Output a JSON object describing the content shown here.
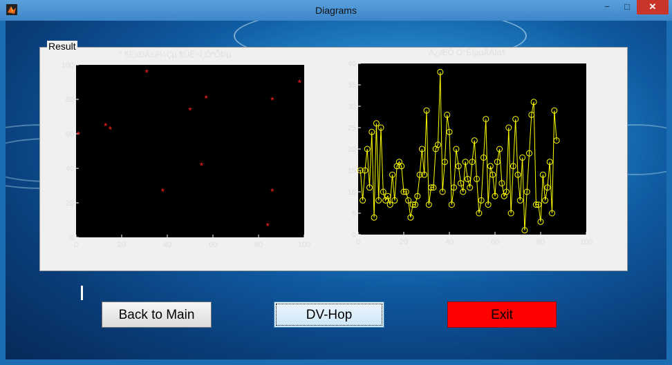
{
  "window": {
    "title": "Diagrams",
    "controls": {
      "minimize": "−",
      "maximize": "□",
      "close": "✕"
    }
  },
  "panel": {
    "title": "Result"
  },
  "buttons": {
    "back": "Back to Main",
    "dvhop": "DV-Hop",
    "exit": "Exit"
  },
  "colors": {
    "exit_bg": "#ff0000",
    "plot_bg": "#000000",
    "scatter_marker": "#ff2020",
    "line_color": "#ffff00"
  },
  "chart_data": [
    {
      "type": "scatter",
      "title": "* ¶ËxÐÂ±ê¼Çµ    ¶ÙË÷Ï¸ÓªÕÞµ",
      "xlim": [
        0,
        100
      ],
      "ylim": [
        0,
        100
      ],
      "xticks": [
        "0",
        "20",
        "40",
        "60",
        "80",
        "100"
      ],
      "yticks": [
        "0",
        "20",
        "40",
        "60",
        "80",
        "100"
      ],
      "marker": "*",
      "x": [
        1,
        13,
        15,
        31,
        38,
        50,
        55,
        57,
        84,
        86,
        86,
        98
      ],
      "y": [
        60,
        65,
        63,
        96,
        27,
        74,
        42,
        81,
        7,
        80,
        27,
        90
      ]
    },
    {
      "type": "line",
      "title": "Ä¿ÆÕ Ó°ÊÏµµÂÁÍá¶",
      "xlim": [
        0,
        100
      ],
      "ylim": [
        0,
        40
      ],
      "xticks": [
        "0",
        "20",
        "40",
        "60",
        "80",
        "100"
      ],
      "yticks": [
        "0",
        "5",
        "10",
        "15",
        "20",
        "25",
        "30",
        "35",
        "40"
      ],
      "marker": "o",
      "y": [
        15,
        8,
        15,
        20,
        11,
        24,
        4,
        26,
        8,
        25,
        10,
        8,
        9,
        7,
        14,
        8,
        16,
        17,
        16,
        10,
        10,
        8,
        4,
        7,
        7,
        9,
        14,
        20,
        14,
        29,
        7,
        11,
        11,
        20,
        21,
        38,
        10,
        17,
        28,
        24,
        7,
        11,
        20,
        16,
        12,
        10,
        17,
        13,
        11,
        17,
        22,
        13,
        5,
        8,
        18,
        27,
        7,
        16,
        14,
        9,
        17,
        20,
        12,
        9,
        10,
        25,
        5,
        16,
        27,
        14,
        8,
        18,
        1,
        10,
        19,
        28,
        31,
        7,
        7,
        3,
        14,
        8,
        11,
        17,
        5,
        29,
        22
      ]
    }
  ]
}
